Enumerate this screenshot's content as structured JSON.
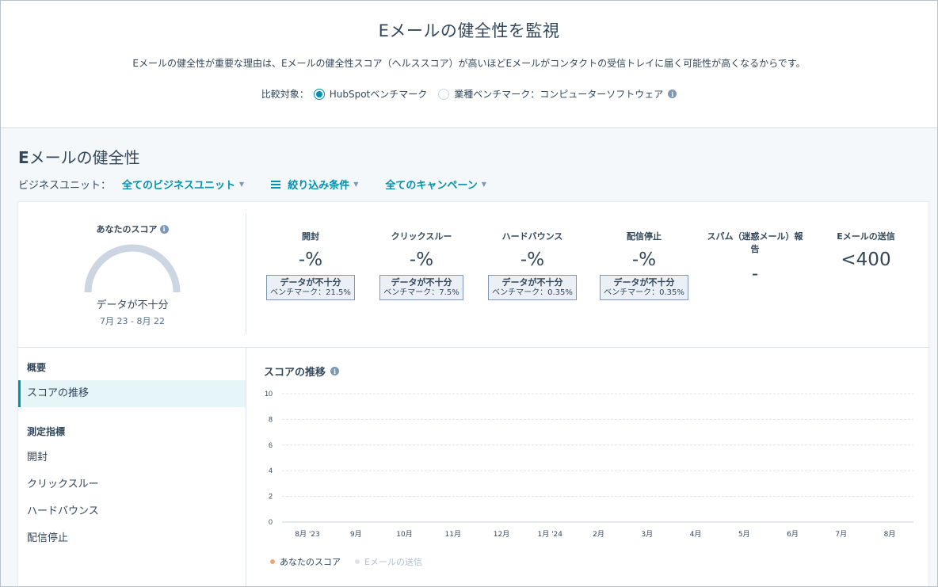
{
  "header": {
    "title": "Eメールの健全性を監視",
    "description": "Eメールの健全性が重要な理由は、Eメールの健全性スコア（ヘルススコア）が高いほどEメールがコンタクトの受信トレイに届く可能性が高くなるからです。",
    "compare_label": "比較対象：",
    "options": [
      {
        "label": "HubSpotベンチマーク",
        "selected": true
      },
      {
        "label": "業種ベンチマーク：コンピューターソフトウェア",
        "selected": false
      }
    ]
  },
  "section": {
    "title_prefix": "E",
    "title_rest": "メールの健全性",
    "bu_label": "ビジネスユニット：",
    "bu_value": "全てのビジネスユニット",
    "filter_label": "絞り込み条件",
    "campaign_label": "全てのキャンペーン"
  },
  "score": {
    "title": "あなたのスコア",
    "nodata": "データが不十分",
    "range": "7月 23 - 8月 22"
  },
  "metrics": [
    {
      "name": "開封",
      "value": "-%",
      "badge_title": "データが不十分",
      "badge_sub": "ベンチマーク：21.5%"
    },
    {
      "name": "クリックスルー",
      "value": "-%",
      "badge_title": "データが不十分",
      "badge_sub": "ベンチマーク：7.5%"
    },
    {
      "name": "ハードバウンス",
      "value": "-%",
      "badge_title": "データが不十分",
      "badge_sub": "ベンチマーク：0.35%"
    },
    {
      "name": "配信停止",
      "value": "-%",
      "badge_title": "データが不十分",
      "badge_sub": "ベンチマーク：0.35%"
    },
    {
      "name": "スパム（迷惑メール）報告",
      "value": "-"
    },
    {
      "name": "Eメールの送信",
      "value": "<400"
    }
  ],
  "sidenav": {
    "group1": "概要",
    "item_trend": "スコアの推移",
    "group2": "測定指標",
    "items": [
      "開封",
      "クリックスルー",
      "ハードバウンス",
      "配信停止"
    ]
  },
  "chart_data": {
    "type": "line",
    "title": "スコアの推移",
    "categories": [
      "8月 '23",
      "9月",
      "10月",
      "11月",
      "12月",
      "1月 '24",
      "2月",
      "3月",
      "4月",
      "5月",
      "6月",
      "7月",
      "8月"
    ],
    "ylim": [
      0,
      10
    ],
    "yticks": [
      0,
      2,
      4,
      6,
      8,
      10
    ],
    "grid": true,
    "series": [
      {
        "name": "あなたのスコア",
        "values": [],
        "color": "#f2a375"
      },
      {
        "name": "Eメールの送信",
        "values": [],
        "color": "#dfe3eb"
      }
    ],
    "legend": "bottom-left"
  },
  "colors": {
    "accent": "#0091ae",
    "text": "#33475b",
    "gauge": "#cbd6e2"
  }
}
